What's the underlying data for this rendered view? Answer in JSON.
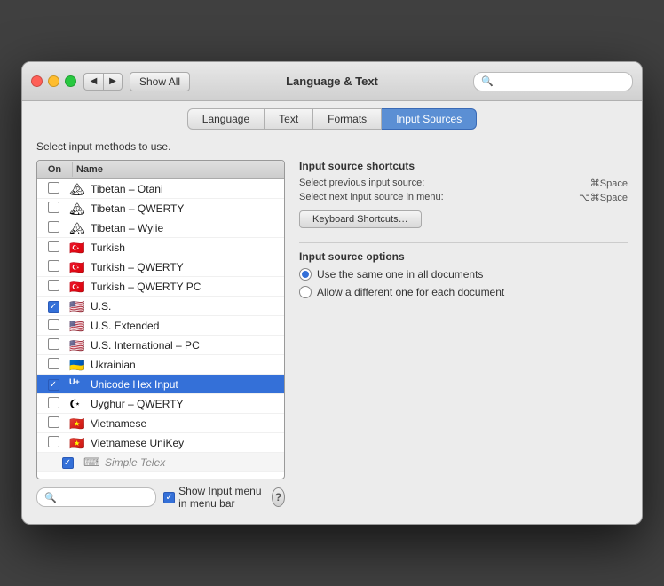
{
  "window": {
    "title": "Language & Text",
    "traffic_lights": [
      "close",
      "minimize",
      "maximize"
    ],
    "nav_back": "◀",
    "nav_forward": "▶",
    "show_all": "Show All",
    "search_placeholder": ""
  },
  "tabs": [
    {
      "id": "language",
      "label": "Language",
      "active": false
    },
    {
      "id": "text",
      "label": "Text",
      "active": false
    },
    {
      "id": "formats",
      "label": "Formats",
      "active": false
    },
    {
      "id": "input-sources",
      "label": "Input Sources",
      "active": true
    }
  ],
  "content": {
    "instruction": "Select input methods to use.",
    "list_header": {
      "col_on": "On",
      "col_name": "Name"
    },
    "items": [
      {
        "checked": false,
        "flag": "🏔",
        "label": "Tibetan – Otani",
        "selected": false
      },
      {
        "checked": false,
        "flag": "🏔",
        "label": "Tibetan – QWERTY",
        "selected": false
      },
      {
        "checked": false,
        "flag": "🏔",
        "label": "Tibetan – Wylie",
        "selected": false
      },
      {
        "checked": false,
        "flag": "🇹🇷",
        "label": "Turkish",
        "selected": false
      },
      {
        "checked": false,
        "flag": "🇹🇷",
        "label": "Turkish – QWERTY",
        "selected": false
      },
      {
        "checked": false,
        "flag": "🇹🇷",
        "label": "Turkish – QWERTY PC",
        "selected": false
      },
      {
        "checked": true,
        "flag": "🇺🇸",
        "label": "U.S.",
        "selected": false
      },
      {
        "checked": false,
        "flag": "🇺🇸",
        "label": "U.S. Extended",
        "selected": false
      },
      {
        "checked": false,
        "flag": "🇺🇸",
        "label": "U.S. International – PC",
        "selected": false
      },
      {
        "checked": false,
        "flag": "🇺🇦",
        "label": "Ukrainian",
        "selected": false
      },
      {
        "checked": true,
        "flag": "🔤",
        "label": "Unicode Hex Input",
        "selected": true
      },
      {
        "checked": false,
        "flag": "🕌",
        "label": "Uyghur – QWERTY",
        "selected": false
      },
      {
        "checked": false,
        "flag": "🇻🇳",
        "label": "Vietnamese",
        "selected": false
      },
      {
        "checked": false,
        "flag": "🇻🇳",
        "label": "Vietnamese UniKey",
        "selected": false
      },
      {
        "checked": true,
        "flag": "⌨",
        "label": "Simple Telex",
        "selected": false,
        "sub": true
      }
    ],
    "bottom_search_placeholder": "",
    "show_menu_label": "Show Input menu in menu bar",
    "show_menu_checked": true,
    "help_label": "?"
  },
  "shortcuts": {
    "title": "Input source shortcuts",
    "previous_label": "Select previous input source:",
    "previous_key": "⌘Space",
    "next_label": "Select next input source in menu:",
    "next_key": "⌥⌘Space",
    "keyboard_btn": "Keyboard Shortcuts…"
  },
  "options": {
    "title": "Input source options",
    "radio_items": [
      {
        "label": "Use the same one in all documents",
        "selected": true
      },
      {
        "label": "Allow a different one for each document",
        "selected": false
      }
    ]
  }
}
